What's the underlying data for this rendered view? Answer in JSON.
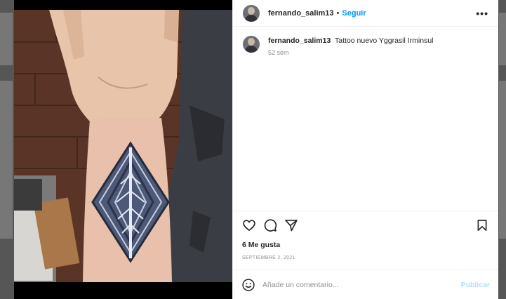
{
  "post": {
    "username": "fernando_salim13",
    "separator": "•",
    "follow_label": "Seguir",
    "more_label": "•••",
    "caption_username": "fernando_salim13",
    "caption_text": "Tattoo nuevo Yggrasil Irminsul",
    "caption_age": "52 sem",
    "likes": "6 Me gusta",
    "date": "SEPTIEMBRE 2, 2021"
  },
  "comment_box": {
    "placeholder": "Añade un comentario...",
    "publish_label": "Publicar"
  },
  "icons": {
    "like": "heart-icon",
    "comment": "comment-bubble-icon",
    "share": "paper-plane-icon",
    "save": "bookmark-icon",
    "emoji": "emoji-smile-icon",
    "more": "more-options-icon"
  },
  "colors": {
    "accent": "#0095f6",
    "publish_disabled": "#b2dffc",
    "text": "#262626",
    "muted": "#8e8e8e"
  }
}
